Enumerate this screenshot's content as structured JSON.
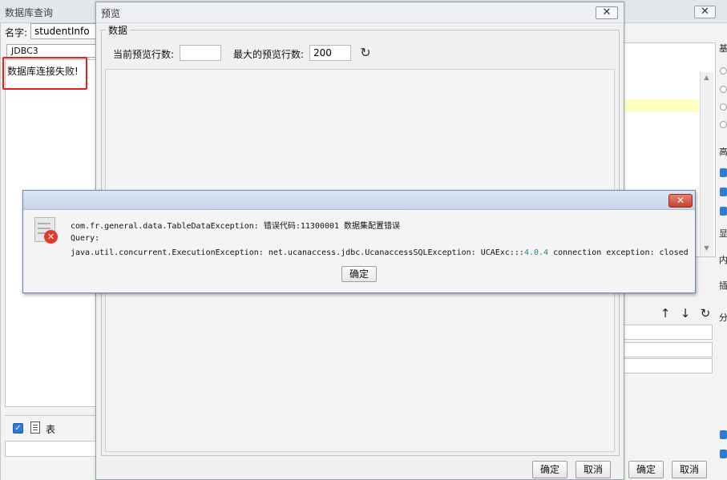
{
  "background_window": {
    "title": "数据库查询",
    "close_glyph": "✕",
    "name_label": "名字:",
    "name_value": "studentInfo",
    "connection": "JDBC3",
    "error_message": "数据库连接失败!",
    "table_checkbox_glyph": "✓",
    "table_label": "表",
    "ok_label": "确定",
    "cancel_label": "取消",
    "edge_text": [
      "基",
      "高",
      "显",
      "内",
      "插",
      "分"
    ]
  },
  "preview_dialog": {
    "title": "预览",
    "close_glyph": "✕",
    "group_label": "数据",
    "current_rows_label": "当前预览行数:",
    "current_rows_value": "",
    "max_rows_label": "最大的预览行数:",
    "max_rows_value": "200",
    "refresh_glyph": "↻",
    "ok_label": "确定",
    "cancel_label": "取消"
  },
  "error_dialog": {
    "close_glyph": "✕",
    "line1": "com.fr.general.data.TableDataException: 错误代码:11300001 数据集配置错误",
    "line2": "Query:",
    "line3_prefix": "java.util.concurrent.ExecutionException: net.ucanaccess.jdbc.UcanaccessSQLException: UCAExc:::",
    "line3_version": "4.0.4",
    "line3_suffix": " connection exception: closed",
    "error_glyph": "✕",
    "ok_label": "确定"
  },
  "toolbar_icons": {
    "up": "↑",
    "down": "↓",
    "refresh": "↻"
  },
  "colors": {
    "highlight_border": "#e0231f",
    "checkbox_blue": "#2e7bd6",
    "error_red": "#e23a2e",
    "version_teal": "#1a8a8a"
  }
}
